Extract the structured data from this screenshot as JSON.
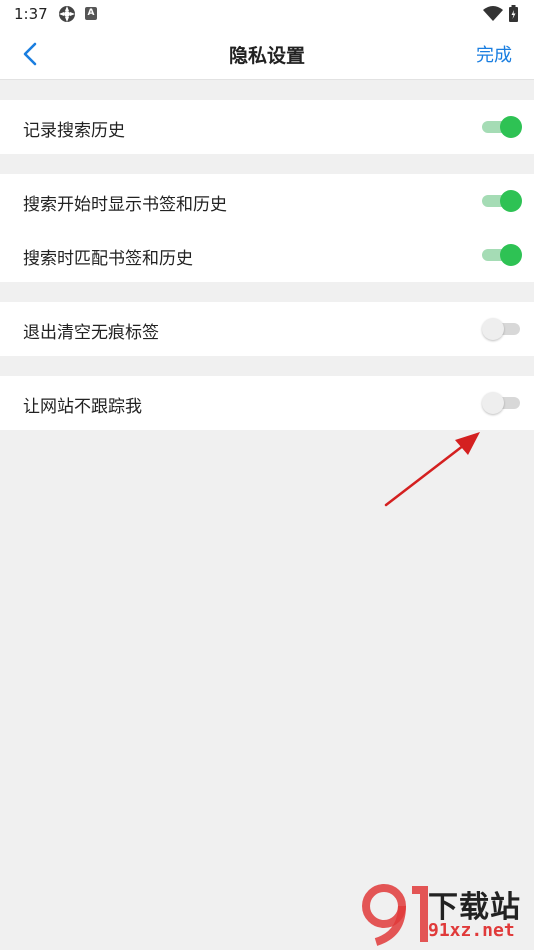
{
  "status_bar": {
    "time": "1:37",
    "icons": [
      "settings-icon",
      "app-a-icon",
      "wifi-icon",
      "battery-icon"
    ]
  },
  "nav": {
    "title": "隐私设置",
    "done_label": "完成",
    "back_icon": "chevron-left-icon",
    "accent_color": "#1a7ee0"
  },
  "settings": {
    "record_history": {
      "label": "记录搜索历史",
      "on": true
    },
    "show_bookmarks_history_on_start": {
      "label": "搜索开始时显示书签和历史",
      "on": true
    },
    "match_bookmarks_history": {
      "label": "搜索时匹配书签和历史",
      "on": true
    },
    "clear_incognito_tabs_on_exit": {
      "label": "退出清空无痕标签",
      "on": false
    },
    "do_not_track": {
      "label": "让网站不跟踪我",
      "on": false
    }
  },
  "colors": {
    "toggle_on": "#2ec254",
    "toggle_off": "#d8d8d8",
    "background": "#f0f0f0",
    "annotation_arrow": "#d42020"
  },
  "watermark": {
    "title": "下载站",
    "domain": "91xz.net",
    "logo": "91-logo"
  }
}
